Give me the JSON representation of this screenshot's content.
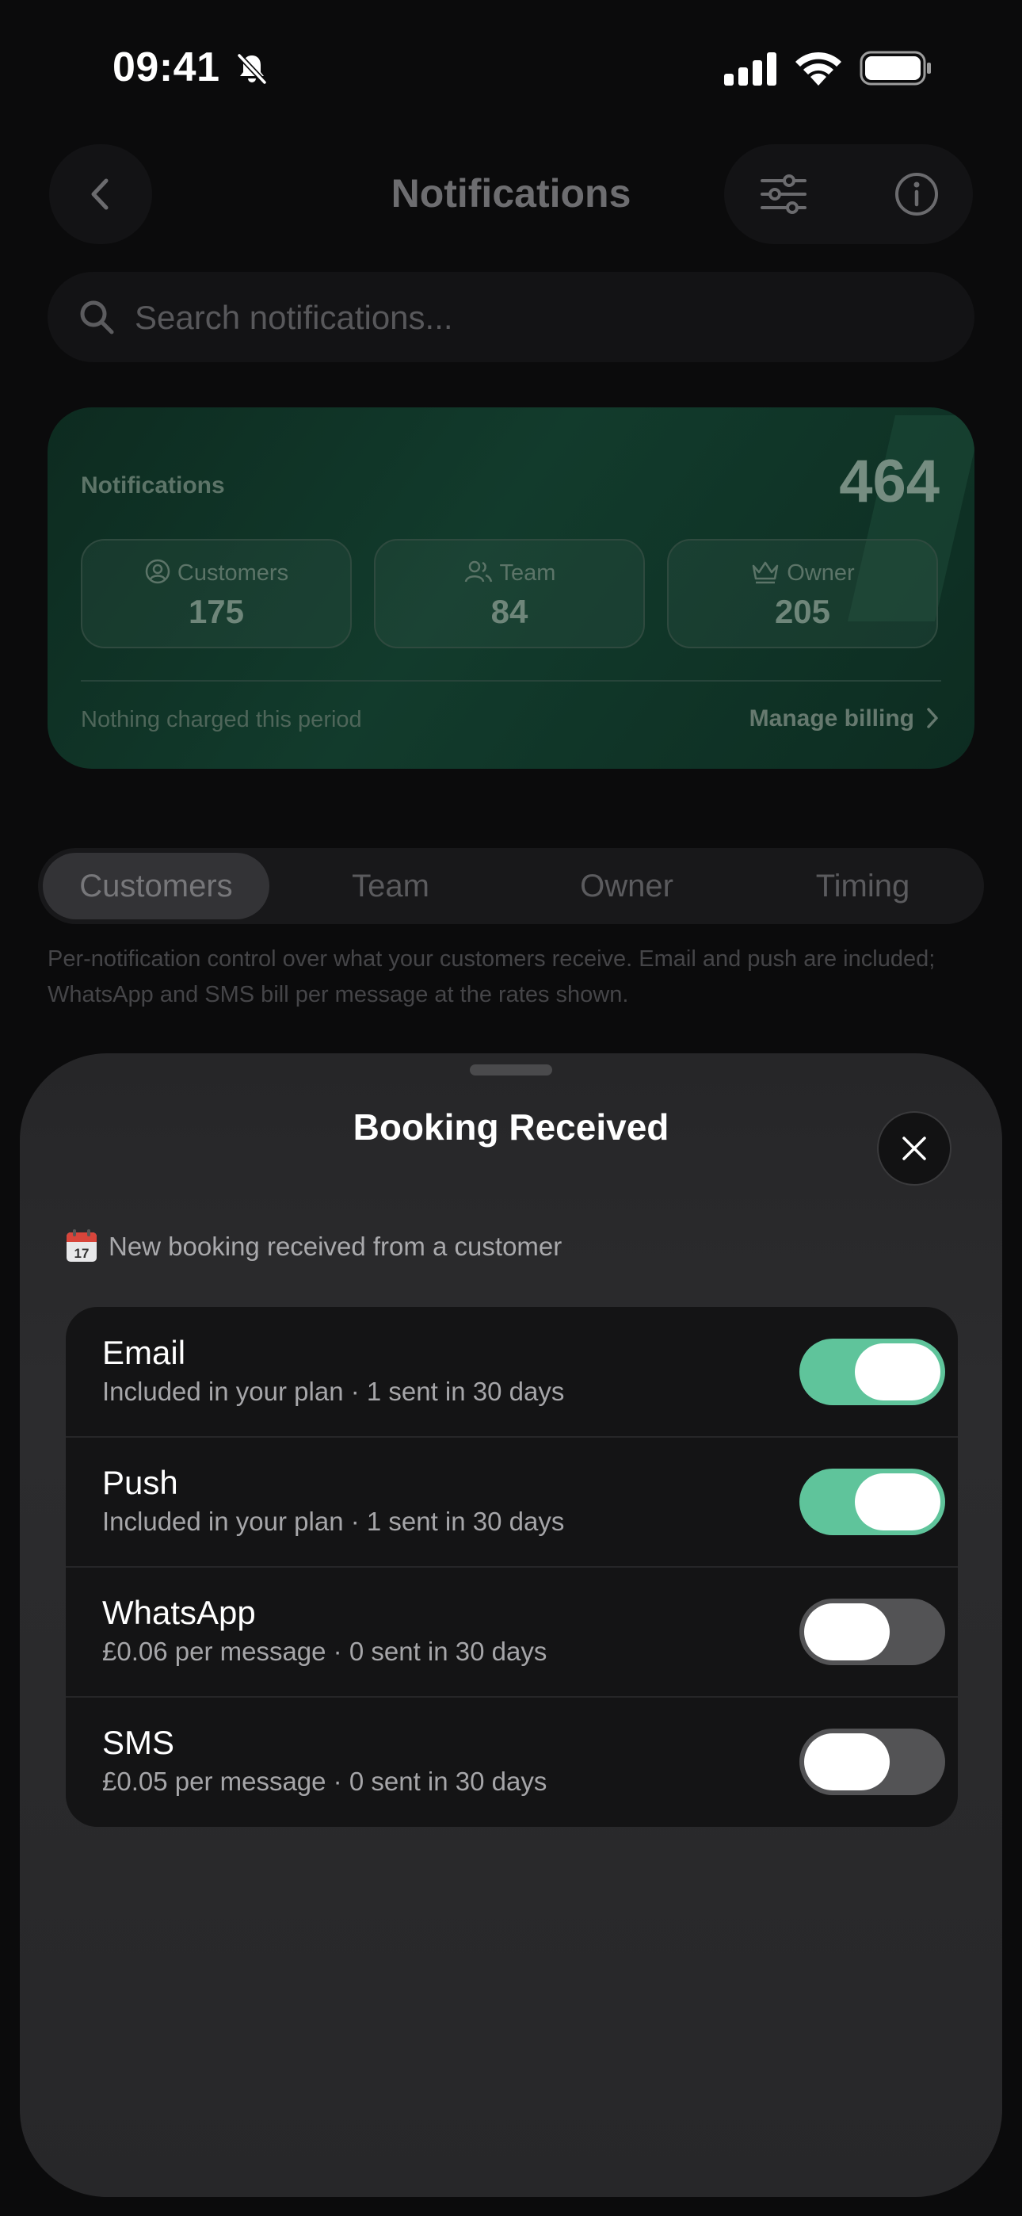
{
  "status_bar": {
    "time": "09:41"
  },
  "header": {
    "title": "Notifications"
  },
  "search": {
    "placeholder": "Search notifications..."
  },
  "summary": {
    "title": "Notifications",
    "total": "464",
    "stats": [
      {
        "label": "Customers",
        "value": "175",
        "icon": "user-circle-icon"
      },
      {
        "label": "Team",
        "value": "84",
        "icon": "users-icon"
      },
      {
        "label": "Owner",
        "value": "205",
        "icon": "crown-icon"
      }
    ],
    "note": "Nothing charged this period",
    "billing_link": "Manage billing"
  },
  "tabs": [
    {
      "label": "Customers",
      "active": true
    },
    {
      "label": "Team",
      "active": false
    },
    {
      "label": "Owner",
      "active": false
    },
    {
      "label": "Timing",
      "active": false
    }
  ],
  "tab_description": "Per-notification control over what your customers receive. Email and push are included; WhatsApp and SMS bill per message at the rates shown.",
  "sheet": {
    "title": "Booking Received",
    "description": "New booking received from a customer",
    "description_icon": "calendar-icon",
    "channels": [
      {
        "name": "Email",
        "detail": "Included in your plan · 1 sent in 30 days",
        "enabled": true
      },
      {
        "name": "Push",
        "detail": "Included in your plan · 1 sent in 30 days",
        "enabled": true
      },
      {
        "name": "WhatsApp",
        "detail": "£0.06 per message · 0 sent in 30 days",
        "enabled": false
      },
      {
        "name": "SMS",
        "detail": "£0.05 per message · 0 sent in 30 days",
        "enabled": false
      }
    ]
  },
  "colors": {
    "toggle_on": "#5fc49b",
    "toggle_off": "#535355",
    "card_green": "#123b2c",
    "sheet_bg": "#2c2c2e"
  }
}
